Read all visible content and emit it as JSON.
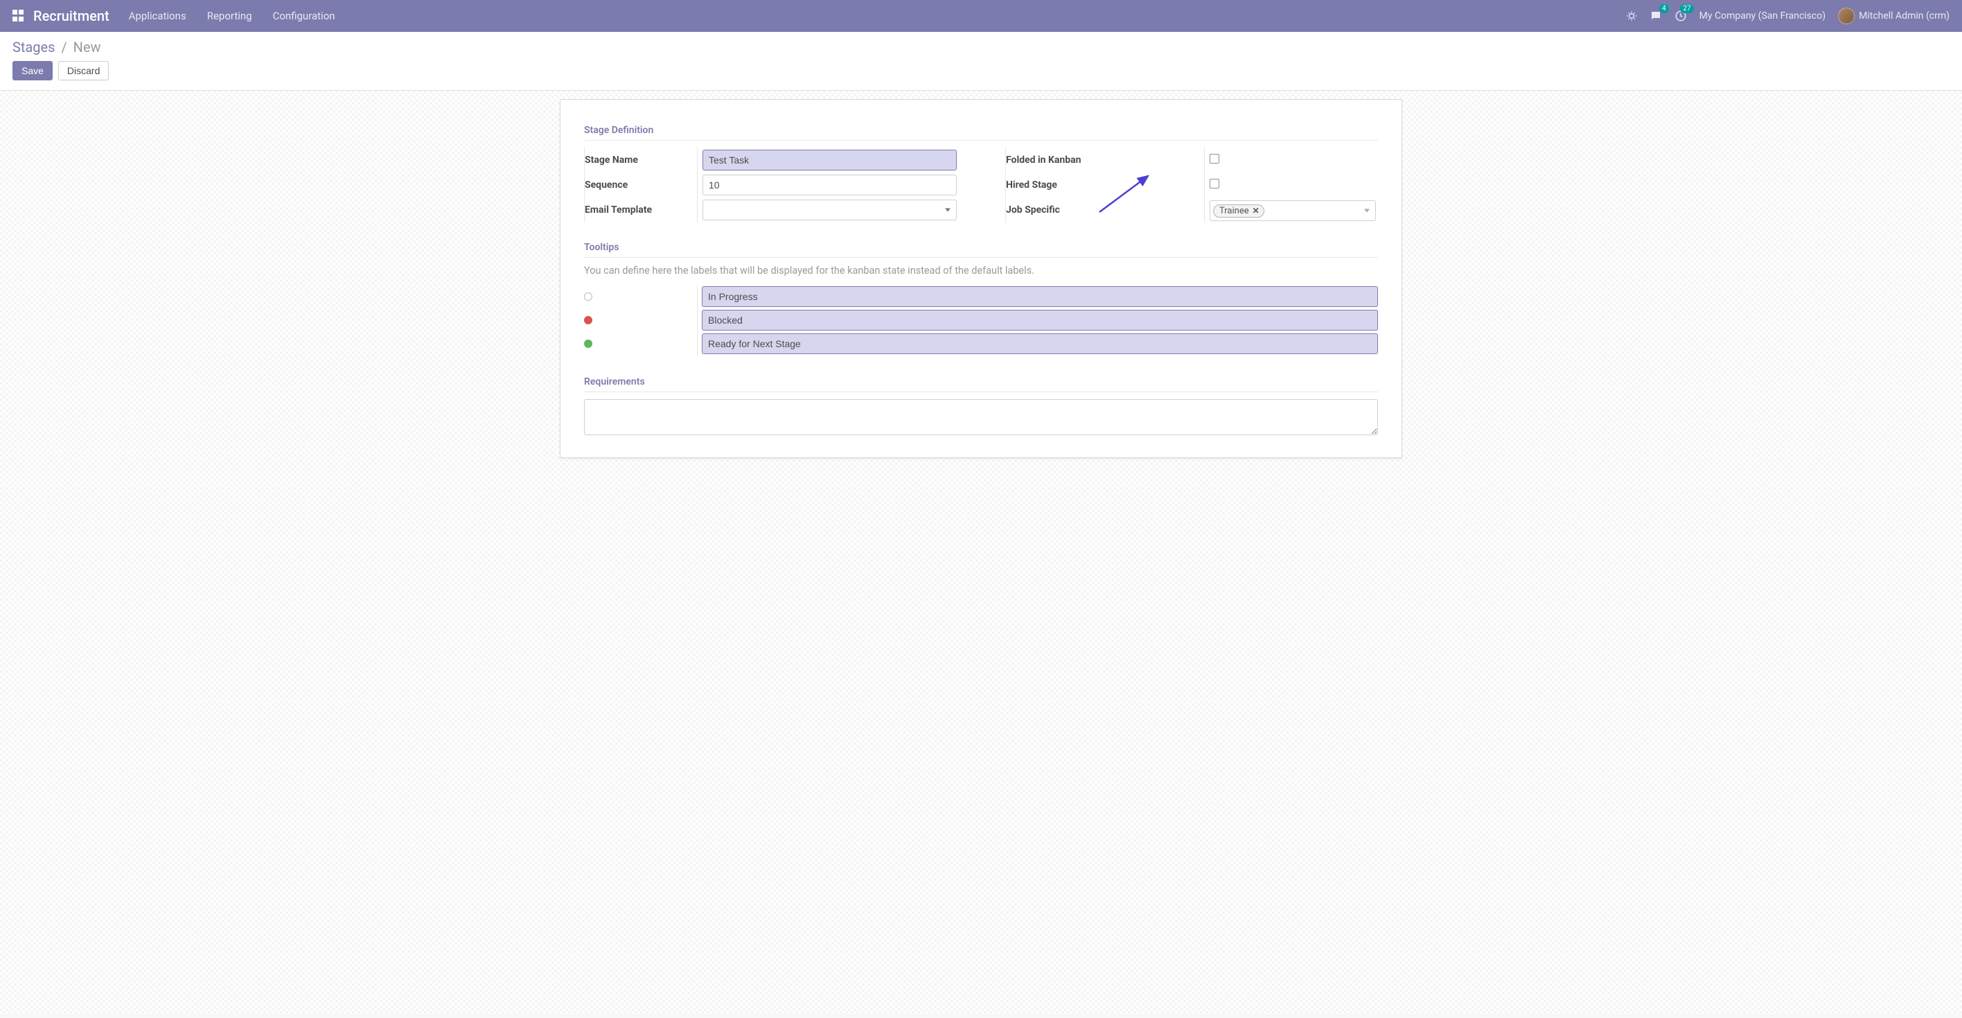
{
  "header": {
    "brand": "Recruitment",
    "nav": [
      "Applications",
      "Reporting",
      "Configuration"
    ],
    "messages_badge": "4",
    "activities_badge": "27",
    "company": "My Company (San Francisco)",
    "user": "Mitchell Admin (crm)"
  },
  "breadcrumb": {
    "parent": "Stages",
    "current": "New"
  },
  "buttons": {
    "save": "Save",
    "discard": "Discard"
  },
  "sections": {
    "stage_definition_title": "Stage Definition",
    "tooltips_title": "Tooltips",
    "tooltips_help": "You can define here the labels that will be displayed for the kanban state instead of the default labels.",
    "requirements_title": "Requirements"
  },
  "fields": {
    "stage_name": {
      "label": "Stage Name",
      "value": "Test Task"
    },
    "sequence": {
      "label": "Sequence",
      "value": "10"
    },
    "email_template": {
      "label": "Email Template",
      "value": ""
    },
    "folded": {
      "label": "Folded in Kanban",
      "checked": false
    },
    "hired": {
      "label": "Hired Stage",
      "checked": false
    },
    "job_specific": {
      "label": "Job Specific",
      "tags": [
        "Trainee"
      ]
    }
  },
  "tooltips": {
    "normal": "In Progress",
    "blocked": "Blocked",
    "done": "Ready for Next Stage"
  },
  "requirements": {
    "value": ""
  }
}
